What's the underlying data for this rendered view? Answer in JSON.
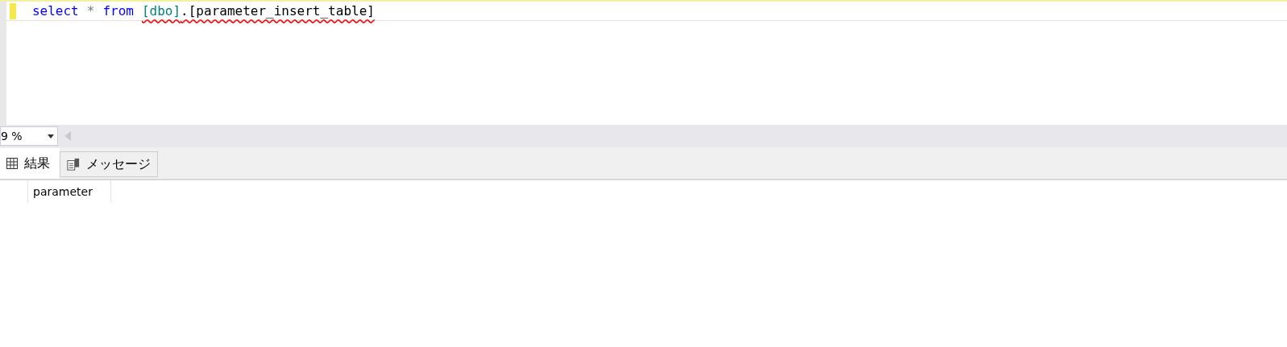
{
  "editor": {
    "line": [
      {
        "kind": "keyword",
        "text": "select"
      },
      {
        "kind": "operator",
        "text": "*"
      },
      {
        "kind": "keyword",
        "text": "from"
      },
      {
        "kind": "schema",
        "text": "[dbo]",
        "squiggle": true
      },
      {
        "kind": "identifier",
        "text": ".[parameter_insert_table]",
        "squiggle": true
      }
    ]
  },
  "zoom": {
    "value": "9 %"
  },
  "tabs": [
    {
      "label": "結果",
      "kind": "grid",
      "selected": true
    },
    {
      "label": "メッセージ",
      "kind": "messages",
      "selected": false
    }
  ],
  "results": {
    "columns": [
      "parameter"
    ]
  }
}
